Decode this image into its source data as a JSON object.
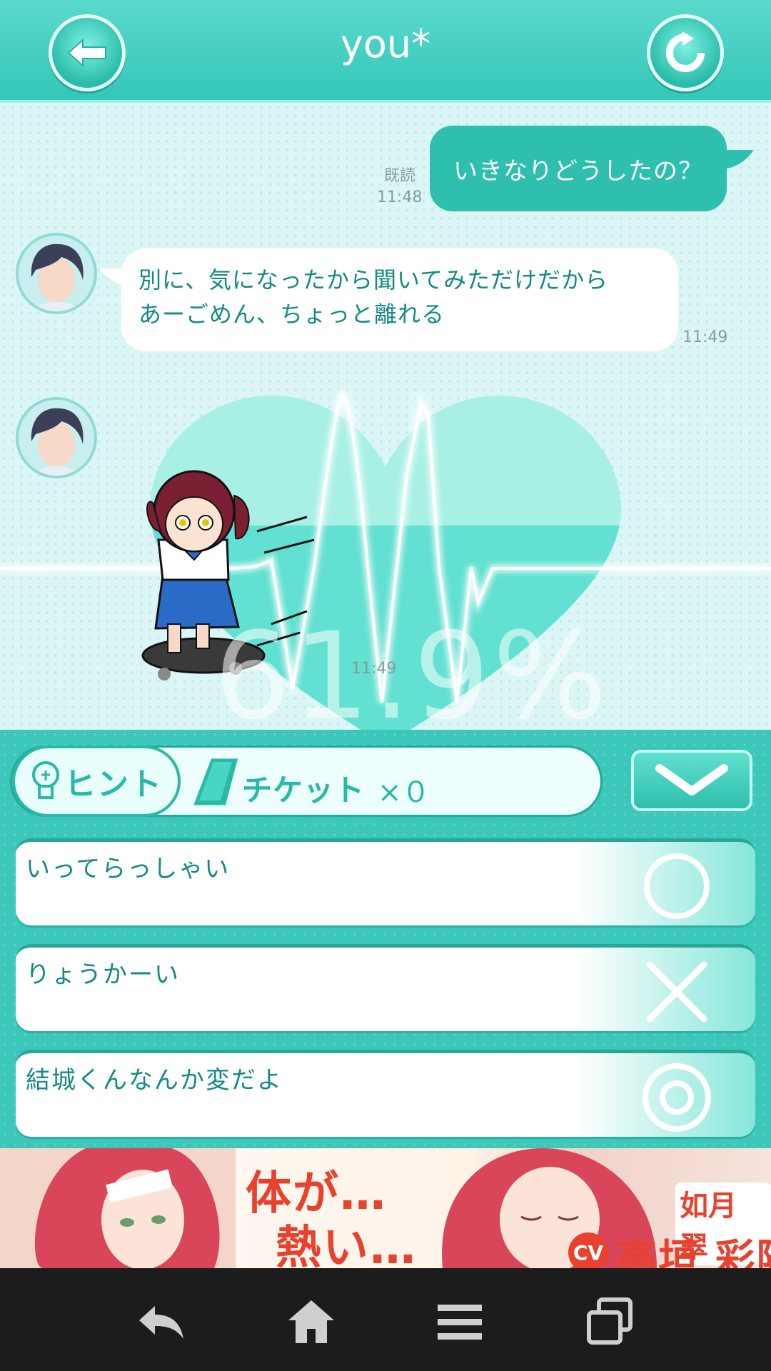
{
  "header": {
    "title": "you*",
    "back_icon": "arrow-left-icon",
    "refresh_icon": "refresh-icon"
  },
  "messages": [
    {
      "from": "me",
      "text": "いきなりどうしたの？",
      "read_label": "既読",
      "time": "11:48"
    },
    {
      "from": "them",
      "lines": [
        "別に、気になったから聞いてみただけだから",
        "あーごめん、ちょっと離れる"
      ],
      "time": "11:49"
    },
    {
      "from": "them",
      "sticker": "heart-meter",
      "percent": "61.9%",
      "time": "11:49"
    }
  ],
  "hint_bar": {
    "hint_label": "ヒント",
    "ticket_label": "チケット",
    "ticket_count": "×０"
  },
  "options": [
    {
      "label": "いってらっしゃい",
      "mark_icon": "circle-icon"
    },
    {
      "label": "りょうかーい",
      "mark_icon": "cross-icon"
    },
    {
      "label": "結城くんなんか変だよ",
      "mark_icon": "double-circle-icon"
    }
  ],
  "ad": {
    "line1": "体が…",
    "line2": "熱い…",
    "name_top": "如月 翠",
    "cv_badge": "CV",
    "name": "高垣 彩陽"
  },
  "colors": {
    "accent": "#34c7b8",
    "bubble_me": "#2ebfae",
    "text_teal": "#138a86",
    "ad_red": "#e8422e"
  }
}
